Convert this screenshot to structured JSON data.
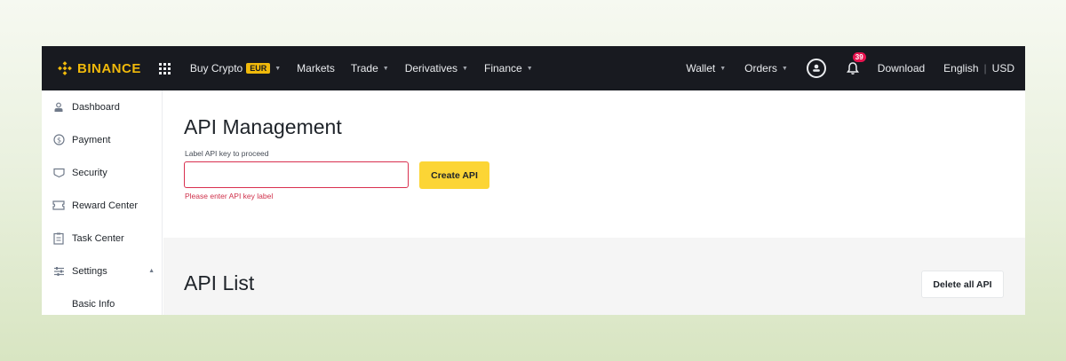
{
  "brand": {
    "name": "BINANCE",
    "accent": "#F0B90B"
  },
  "topnav": {
    "left_items": [
      {
        "label": "Buy Crypto",
        "badge": "EUR",
        "has_caret": true
      },
      {
        "label": "Markets",
        "has_caret": false
      },
      {
        "label": "Trade",
        "has_caret": true
      },
      {
        "label": "Derivatives",
        "has_caret": true
      },
      {
        "label": "Finance",
        "has_caret": true
      }
    ],
    "wallet": "Wallet",
    "orders": "Orders",
    "notification_count": "39",
    "download": "Download",
    "language": "English",
    "currency": "USD"
  },
  "sidebar": {
    "items": [
      {
        "label": "Dashboard",
        "icon": "user-icon"
      },
      {
        "label": "Payment",
        "icon": "dollar-icon"
      },
      {
        "label": "Security",
        "icon": "shield-icon"
      },
      {
        "label": "Reward Center",
        "icon": "ticket-icon"
      },
      {
        "label": "Task Center",
        "icon": "clipboard-icon"
      },
      {
        "label": "Settings",
        "icon": "sliders-icon",
        "expanded": true
      },
      {
        "label": "Basic Info",
        "sub": true
      }
    ]
  },
  "main": {
    "title": "API Management",
    "field_label": "Label API key to proceed",
    "input_value": "",
    "create_button": "Create API",
    "error": "Please enter API key label",
    "list_title": "API List",
    "delete_all_button": "Delete all API"
  }
}
